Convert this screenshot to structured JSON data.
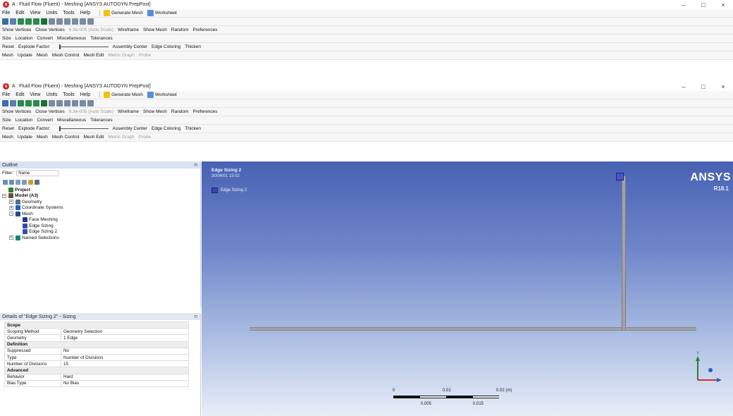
{
  "titlebar": {
    "back_title": "A : Fluid Flow (Fluent) - Meshing [ANSYS AUTODYN PrepPost]",
    "front_title": "A : Fluid Flow (Fluent) - Meshing [ANSYS AUTODYN PrepPost]",
    "minimize": "–",
    "maximize": "□",
    "close": "×"
  },
  "menubar": {
    "items": [
      "File",
      "Edit",
      "View",
      "Units",
      "Tools",
      "Help"
    ],
    "generate_mesh": "Generate Mesh",
    "worksheet": "Worksheet"
  },
  "vertex_bar": {
    "show_vertices": "Show Vertices",
    "close_vertices": "Close Vertices",
    "auto_scale": "6.3e-005 (Auto Scale)",
    "wireframe": "Wireframe",
    "show_mesh": "Show Mesh",
    "random": "Random",
    "preferences": "Preferences"
  },
  "size_bar": {
    "size": "Size",
    "location": "Location",
    "convert": "Convert",
    "miscellaneous": "Miscellaneous",
    "tolerances": "Tolerances"
  },
  "explode_bar": {
    "reset": "Reset",
    "explode_factor": "Explode Factor:",
    "assembly_center": "Assembly Center",
    "edge_coloring": "Edge Coloring",
    "thicken": "Thicken"
  },
  "mesh_bar": {
    "mesh": "Mesh",
    "update": "Update",
    "mesh_menu": "Mesh",
    "mesh_control": "Mesh Control",
    "mesh_edit": "Mesh Edit",
    "metric_graph": "Metric Graph",
    "probe": "Probe"
  },
  "outline": {
    "header": "Outline",
    "filter_label": "Filter:",
    "filter_value": "Name",
    "tree": [
      {
        "label": "Project",
        "level": 0,
        "bold": true,
        "exp": "",
        "color": "#2e7d32"
      },
      {
        "label": "Model (A3)",
        "level": 0,
        "bold": true,
        "exp": "−",
        "color": "#6d4c41"
      },
      {
        "label": "Geometry",
        "level": 1,
        "bold": false,
        "exp": "+",
        "color": "#5d6d7e"
      },
      {
        "label": "Coordinate Systems",
        "level": 1,
        "bold": false,
        "exp": "+",
        "color": "#1565c0"
      },
      {
        "label": "Mesh",
        "level": 1,
        "bold": false,
        "exp": "−",
        "color": "#1e4b8f"
      },
      {
        "label": "Face Meshing",
        "level": 2,
        "bold": false,
        "exp": "",
        "color": "#283593"
      },
      {
        "label": "Edge Sizing",
        "level": 2,
        "bold": false,
        "exp": "",
        "color": "#3949ab"
      },
      {
        "label": "Edge Sizing 2",
        "level": 2,
        "bold": false,
        "exp": "",
        "color": "#3949ab"
      },
      {
        "label": "Named Selections",
        "level": 1,
        "bold": false,
        "exp": "+",
        "color": "#00897b"
      }
    ]
  },
  "details": {
    "header": "Details of \"Edge Sizing 2\" - Sizing",
    "rows": [
      {
        "group": true,
        "key": "Scope",
        "value": ""
      },
      {
        "group": false,
        "key": "Scoping Method",
        "value": "Geometry Selection"
      },
      {
        "group": false,
        "key": "Geometry",
        "value": "1 Edge"
      },
      {
        "group": true,
        "key": "Definition",
        "value": ""
      },
      {
        "group": false,
        "key": "Suppressed",
        "value": "No"
      },
      {
        "group": false,
        "key": "Type",
        "value": "Number of Divisions"
      },
      {
        "group": false,
        "key": "Number of Divisions",
        "value": "15"
      },
      {
        "group": true,
        "key": "Advanced",
        "value": ""
      },
      {
        "group": false,
        "key": "Behavior",
        "value": "Hard"
      },
      {
        "group": false,
        "key": "Bias Type",
        "value": "No Bias"
      }
    ]
  },
  "viewport": {
    "title": "Edge Sizing 2",
    "date": "30/04/01 15:52",
    "legend_label": "Edge Sizing 2",
    "brand": "ANSYS",
    "version": "R18.1",
    "scale": {
      "top_labels": [
        "0",
        "0.01",
        "0.02 (m)"
      ],
      "bottom_labels": [
        "0.005",
        "0.015"
      ]
    },
    "axis_y": "Y"
  },
  "colors": {
    "accent": "#1e5aa8",
    "viewport_top": "#4862b3",
    "viewport_bottom": "#e8eef8",
    "axis_x": "#d32f2f",
    "axis_y": "#2e7d32",
    "axis_z": "#1565c0"
  }
}
